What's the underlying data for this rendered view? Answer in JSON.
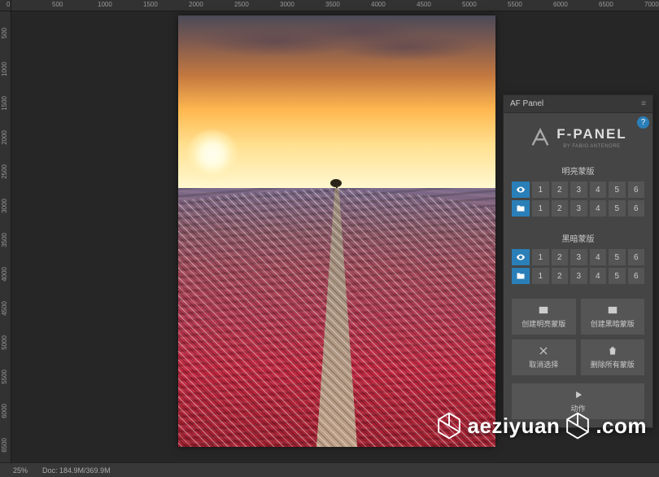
{
  "ruler": {
    "horizontal": [
      "0",
      "500",
      "1000",
      "1500",
      "2000",
      "2500",
      "3000",
      "3500",
      "4000",
      "4500",
      "5000",
      "5500",
      "6000",
      "6500",
      "7000"
    ],
    "vertical": [
      "500",
      "1000",
      "1500",
      "2000",
      "2500",
      "3000",
      "3500",
      "4000",
      "4500",
      "5000",
      "5500",
      "6000",
      "6500"
    ]
  },
  "status": {
    "zoom": "25%",
    "doc_info": "Doc: 184.9M/369.9M"
  },
  "panel": {
    "tab": "AF Panel",
    "brand_name": "F-PANEL",
    "brand_sub": "BY FABIO ANTENORE",
    "section_light": "明亮蒙版",
    "section_dark": "黑暗蒙版",
    "levels": [
      "1",
      "2",
      "3",
      "4",
      "5",
      "6"
    ],
    "actions": {
      "create_light": "创建明亮蒙版",
      "create_dark": "创建黑暗蒙版",
      "deselect": "取消选择",
      "delete_all": "删除所有蒙版",
      "action": "动作"
    }
  },
  "watermark": {
    "text1": "aeziyuan",
    "text2": ".com"
  }
}
